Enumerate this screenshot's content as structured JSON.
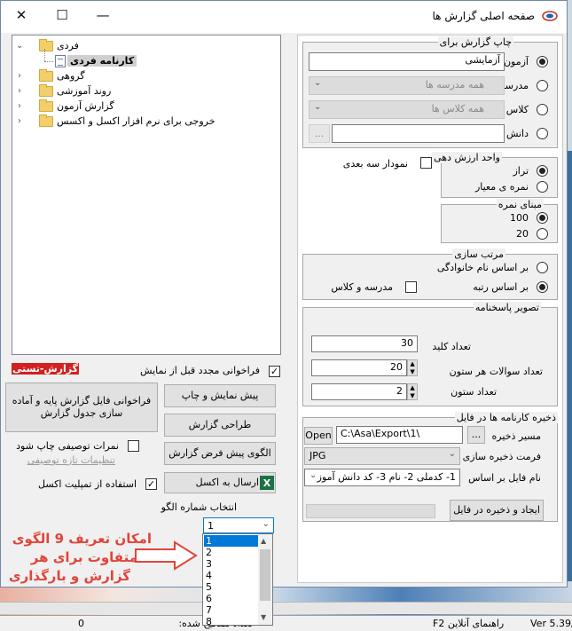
{
  "window": {
    "title": "صفحه اصلی گزارش ها"
  },
  "tree": {
    "items": [
      {
        "label": "فردی",
        "expanded": true
      },
      {
        "label": "کارنامه فردی",
        "child": true,
        "selected": true
      },
      {
        "label": "گروهی"
      },
      {
        "label": "روند آموزشی"
      },
      {
        "label": "گزارش آزمون"
      },
      {
        "label": "خروجی برای نرم افزار اکسل و اکسس"
      }
    ]
  },
  "left": {
    "badge": "گزارش-تستی",
    "reload_check_label": "فراخوانی مجدد قبل از نمایش",
    "reload_base_button": "فراخوانی فایل گزارش پایه و آماده سازی جدول گزارش",
    "preview_print_button": "پیش نمایش و چاپ",
    "design_button": "طراحی گزارش",
    "default_template_button": "الگوی پیش فرض گزارش",
    "descriptive_grades_label": "نمرات توصیفی چاپ شود",
    "descriptive_settings_link": "تنظیمات تازه توصیفی",
    "excel_template_label": "استفاده از تمپلیت اکسل",
    "send_excel_button": "ارسال به  اکسل",
    "template_select_label": "انتخاب شماره الگو",
    "template_selected": "1",
    "template_options": [
      "1",
      "2",
      "3",
      "4",
      "5",
      "6",
      "7",
      "8"
    ],
    "annotation": [
      "امکان تعریف 9 الگوی",
      "متفاوت برای هر",
      "گزارش و بارگذاری"
    ]
  },
  "right": {
    "print_for": {
      "title": "چاپ گزارش برای",
      "exam_label": "آزمون",
      "exam_value": "آزمایشی",
      "school_label": "مدرسه",
      "school_value": "همه مدرسه ها",
      "class_label": "کلاس",
      "class_value": "همه کلاس ها",
      "student_label": "دانش آموز",
      "browse": "..."
    },
    "score_unit": {
      "title": "واحد ارزش دهی",
      "taraz": "تراز",
      "grade": "نمره ی معیار"
    },
    "chart3d_label": "نمودار سه بعدی",
    "score_base": {
      "title": "مبنای نمره",
      "opt100": "100",
      "opt20": "20"
    },
    "sort": {
      "title": "مرتب سازی",
      "by_family": "بر اساس نام خانوادگی",
      "by_rank": "بر اساس رتبه",
      "school_class": "مدرسه و کلاس"
    },
    "answer_image": {
      "title": "تصویر پاسخنامه",
      "key_label": "تعداد کلید",
      "key_value": "30",
      "per_col_label": "تعداد سوالات هر ستون",
      "per_col_value": "20",
      "cols_label": "تعداد ستون",
      "cols_value": "2"
    },
    "save_file": {
      "title": "ذخیره کارنامه ها در فایل",
      "open_button": "Open",
      "path_value": "C:\\Asa\\Export\\1\\",
      "browse": "...",
      "path_label": "مسیر ذخیره",
      "format_value": "JPG",
      "format_label": "فرمت ذخیره سازی",
      "name_value": "1- کدملی 2- نام  3- کد دانش آموز",
      "name_label": "نام فایل بر اساس",
      "create_button": "ایجاد و ذخیره در فایل"
    }
  },
  "status": {
    "count_label": "تعداد تصحیح شده:",
    "count_value": "0",
    "help": "راهنمای آنلاین F2",
    "version": "Ver 5.39/"
  }
}
